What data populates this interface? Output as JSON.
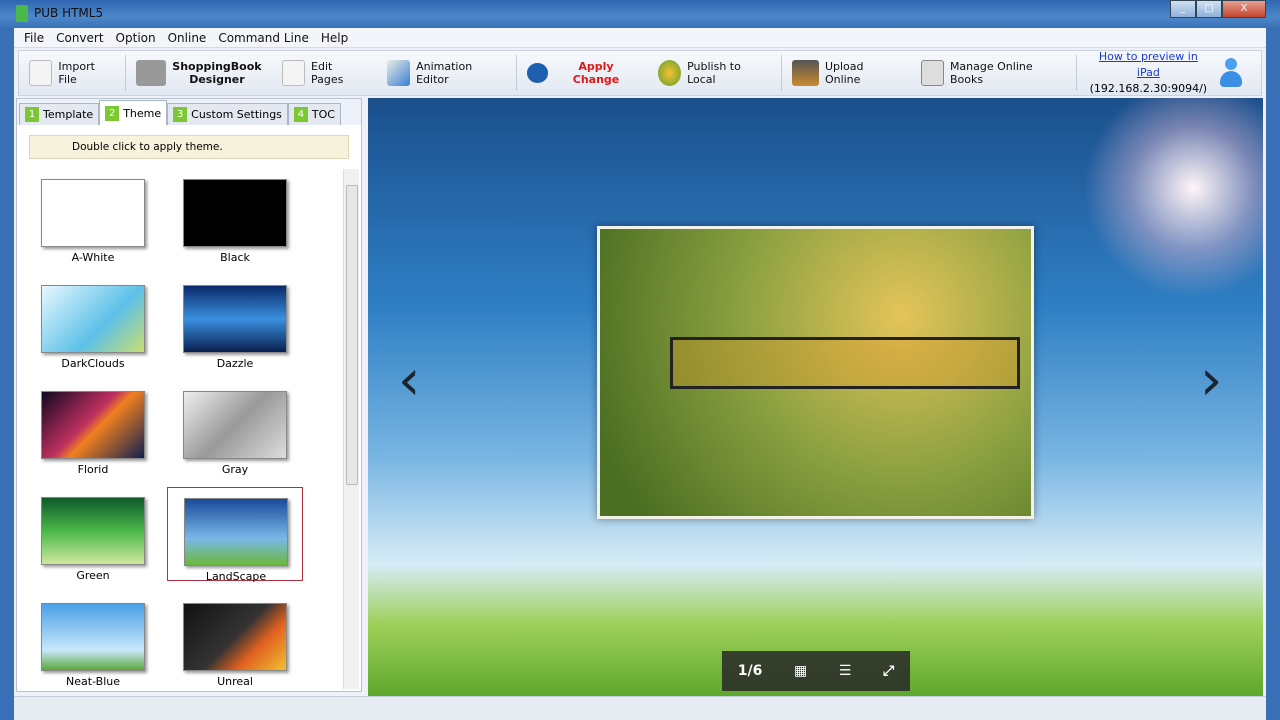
{
  "window": {
    "title": "PUB HTML5"
  },
  "menu": [
    "File",
    "Convert",
    "Option",
    "Online",
    "Command Line",
    "Help"
  ],
  "toolbar": {
    "import": "Import File",
    "shop1": "ShoppingBook",
    "shop2": "Designer",
    "edit": "Edit Pages",
    "anim": "Animation Editor",
    "apply": "Apply Change",
    "publish": "Publish to Local",
    "upload": "Upload Online",
    "manage": "Manage Online Books",
    "preview_link": "How to preview in iPad",
    "preview_addr": "(192.168.2.30:9094/)"
  },
  "tabs": [
    {
      "n": "1",
      "label": "Template"
    },
    {
      "n": "2",
      "label": "Theme"
    },
    {
      "n": "3",
      "label": "Custom Settings"
    },
    {
      "n": "4",
      "label": "TOC"
    }
  ],
  "hint": "Double click to apply theme.",
  "themes": [
    "A-White",
    "Black",
    "DarkClouds",
    "Dazzle",
    "Florid",
    "Gray",
    "Green",
    "LandScape",
    "Neat-Blue",
    "Unreal"
  ],
  "selected_theme": "LandScape",
  "pager": {
    "page": "1/6"
  }
}
